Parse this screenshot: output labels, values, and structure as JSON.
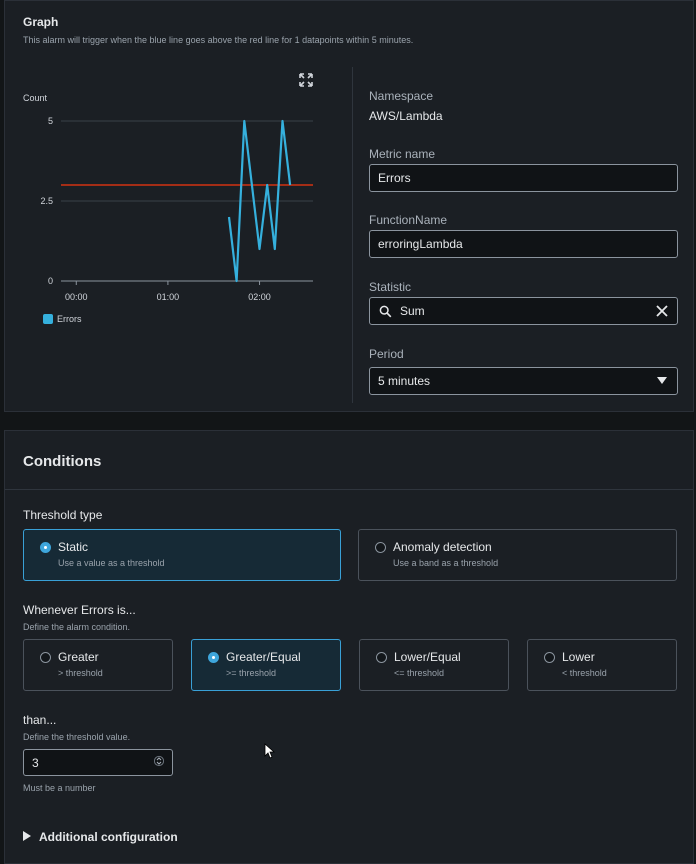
{
  "graph": {
    "title": "Graph",
    "subtitle": "This alarm will trigger when the blue line goes above the red line for 1 datapoints within 5 minutes.",
    "expand_icon": "expand-icon"
  },
  "chart_data": {
    "type": "line",
    "ylabel": "Count",
    "yticks": [
      "0",
      "2.5",
      "5"
    ],
    "ylim": [
      0,
      5
    ],
    "xticks": [
      "00:00",
      "01:00",
      "02:00"
    ],
    "grid": true,
    "legend": {
      "placement": "bottom-left",
      "entries": [
        "Errors"
      ]
    },
    "series": [
      {
        "name": "Errors",
        "color": "#35b0dd",
        "x": [
          "01:40",
          "01:45",
          "01:50",
          "01:55",
          "02:00",
          "02:05",
          "02:10",
          "02:15",
          "02:20"
        ],
        "values": [
          2,
          0,
          5,
          3,
          1,
          3,
          1,
          5,
          3
        ]
      }
    ],
    "threshold": {
      "value": 3,
      "color": "#d13212"
    }
  },
  "metric": {
    "namespace_label": "Namespace",
    "namespace_value": "AWS/Lambda",
    "metric_name_label": "Metric name",
    "metric_name_value": "Errors",
    "function_label": "FunctionName",
    "function_value": "erroringLambda",
    "statistic_label": "Statistic",
    "statistic_value": "Sum",
    "period_label": "Period",
    "period_value": "5 minutes"
  },
  "conditions": {
    "title": "Conditions",
    "threshold_type_label": "Threshold type",
    "threshold_types": [
      {
        "title": "Static",
        "desc": "Use a value as a threshold",
        "selected": true
      },
      {
        "title": "Anomaly detection",
        "desc": "Use a band as a threshold",
        "selected": false
      }
    ],
    "whenever_label": "Whenever Errors is...",
    "whenever_desc": "Define the alarm condition.",
    "operators": [
      {
        "title": "Greater",
        "desc": "> threshold",
        "selected": false
      },
      {
        "title": "Greater/Equal",
        "desc": ">= threshold",
        "selected": true
      },
      {
        "title": "Lower/Equal",
        "desc": "<= threshold",
        "selected": false
      },
      {
        "title": "Lower",
        "desc": "< threshold",
        "selected": false
      }
    ],
    "than_label": "than...",
    "than_desc": "Define the threshold value.",
    "threshold_value": "3",
    "threshold_hint": "Must be a number",
    "additional_label": "Additional configuration"
  },
  "colors": {
    "accent": "#39a0d6",
    "series": "#35b0dd",
    "threshold": "#d13212"
  }
}
